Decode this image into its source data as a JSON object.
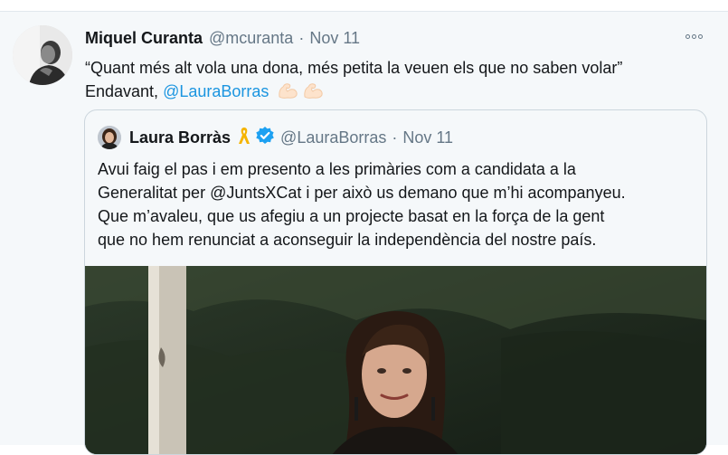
{
  "tweet": {
    "name": "Miquel Curanta",
    "handle": "@mcuranta",
    "separator": "·",
    "date": "Nov 11",
    "line1": "“Quant més alt vola una dona, més petita la veuen els que no saben volar”",
    "line2_prefix": "Endavant, ",
    "mention": "@LauraBorras",
    "emoji_icons": [
      "flexed-biceps-icon",
      "flexed-biceps-icon"
    ],
    "more_icon": "more-options-icon"
  },
  "quote": {
    "name": "Laura Borràs",
    "handle": "@LauraBorras",
    "separator": "·",
    "date": "Nov 11",
    "badges": [
      "yellow-ribbon-icon",
      "verified-badge-icon"
    ],
    "text_lines": [
      "Avui faig el pas i em presento a les primàries com a candidata a la",
      "Generalitat per @JuntsXCat i per això us demano que m’hi acompanyeu.",
      "Que m’avaleu, que us afegiu a un projecte basat en la força de la gent",
      "que no hem renunciat a aconseguir la independència del nostre país."
    ]
  },
  "colors": {
    "background": "#f5f8fa",
    "text": "#14171a",
    "muted": "#657786",
    "link": "#1b95e0",
    "verified": "#1da1f2",
    "ribbon": "#f5b400",
    "border": "#ccd6dd"
  }
}
